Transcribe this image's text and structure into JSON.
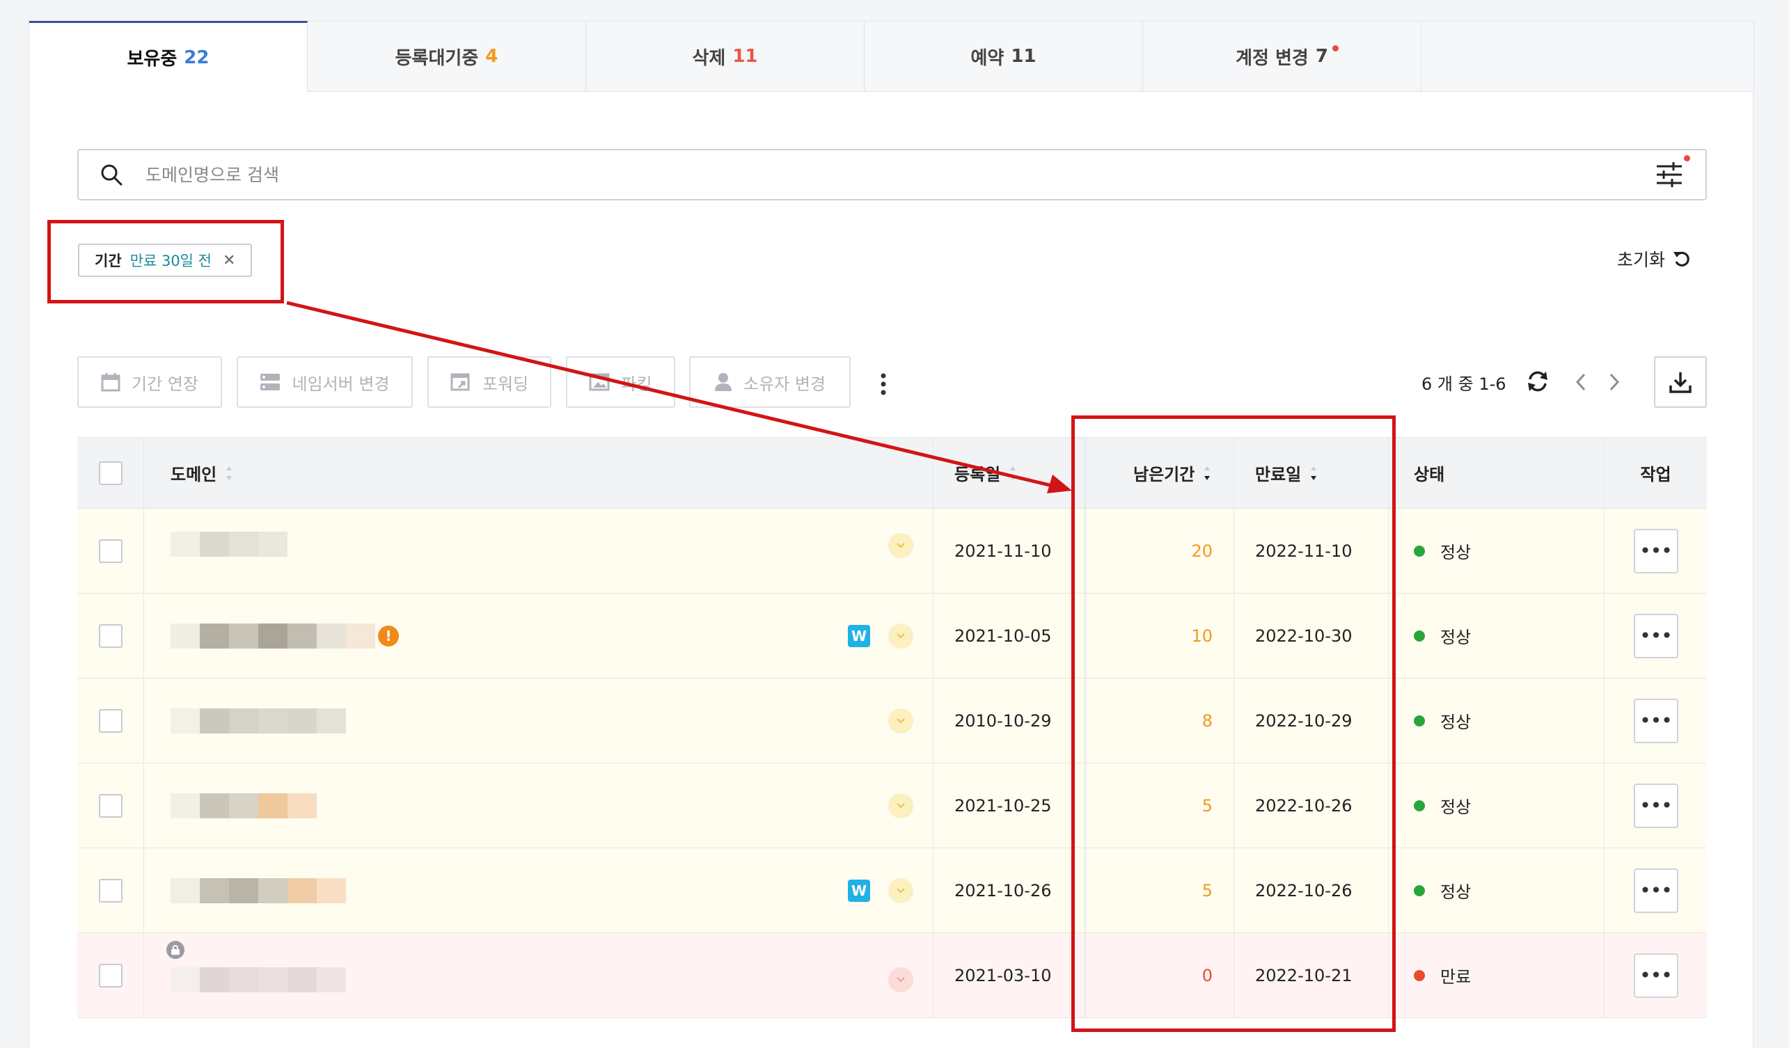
{
  "tabs": [
    {
      "label": "보유중",
      "count": "22",
      "count_color": "#3b7dd8"
    },
    {
      "label": "등록대기중",
      "count": "4",
      "count_color": "#f29a1f"
    },
    {
      "label": "삭제",
      "count": "11",
      "count_color": "#e8584a"
    },
    {
      "label": "예약",
      "count": "11",
      "count_color": "#444444"
    },
    {
      "label": "계정 변경",
      "count": "7",
      "count_color": "#444444"
    }
  ],
  "search": {
    "placeholder": "도메인명으로 검색",
    "value": ""
  },
  "filter_chip": {
    "key": "기간",
    "value": "만료 30일 전"
  },
  "reset_label": "초기화",
  "toolbar": {
    "extend": "기간 연장",
    "nameserver": "네임서버 변경",
    "forwarding": "포워딩",
    "parking": "파킹",
    "owner": "소유자 변경"
  },
  "pager": {
    "text": "6 개 중 1-6"
  },
  "table": {
    "headers": {
      "domain": "도메인",
      "registered": "등록일",
      "remaining": "남은기간",
      "expires": "만료일",
      "status": "상태",
      "action": "작업"
    },
    "rows": [
      {
        "registered": "2021-11-10",
        "remaining": "20",
        "expires": "2022-11-10",
        "status": "정상"
      },
      {
        "registered": "2021-10-05",
        "remaining": "10",
        "expires": "2022-10-30",
        "status": "정상"
      },
      {
        "registered": "2010-10-29",
        "remaining": "8",
        "expires": "2022-10-29",
        "status": "정상"
      },
      {
        "registered": "2021-10-25",
        "remaining": "5",
        "expires": "2022-10-26",
        "status": "정상"
      },
      {
        "registered": "2021-10-26",
        "remaining": "5",
        "expires": "2022-10-26",
        "status": "정상"
      },
      {
        "registered": "2021-03-10",
        "remaining": "0",
        "expires": "2022-10-21",
        "status": "만료"
      }
    ],
    "action_label": "•••",
    "w_badge": "W",
    "alert_mark": "!"
  },
  "colors": {
    "accent": "#3d4aa8",
    "warning": "#f29a1f",
    "danger": "#e84a35",
    "ok": "#2aa53a",
    "annotation": "#d21416"
  }
}
